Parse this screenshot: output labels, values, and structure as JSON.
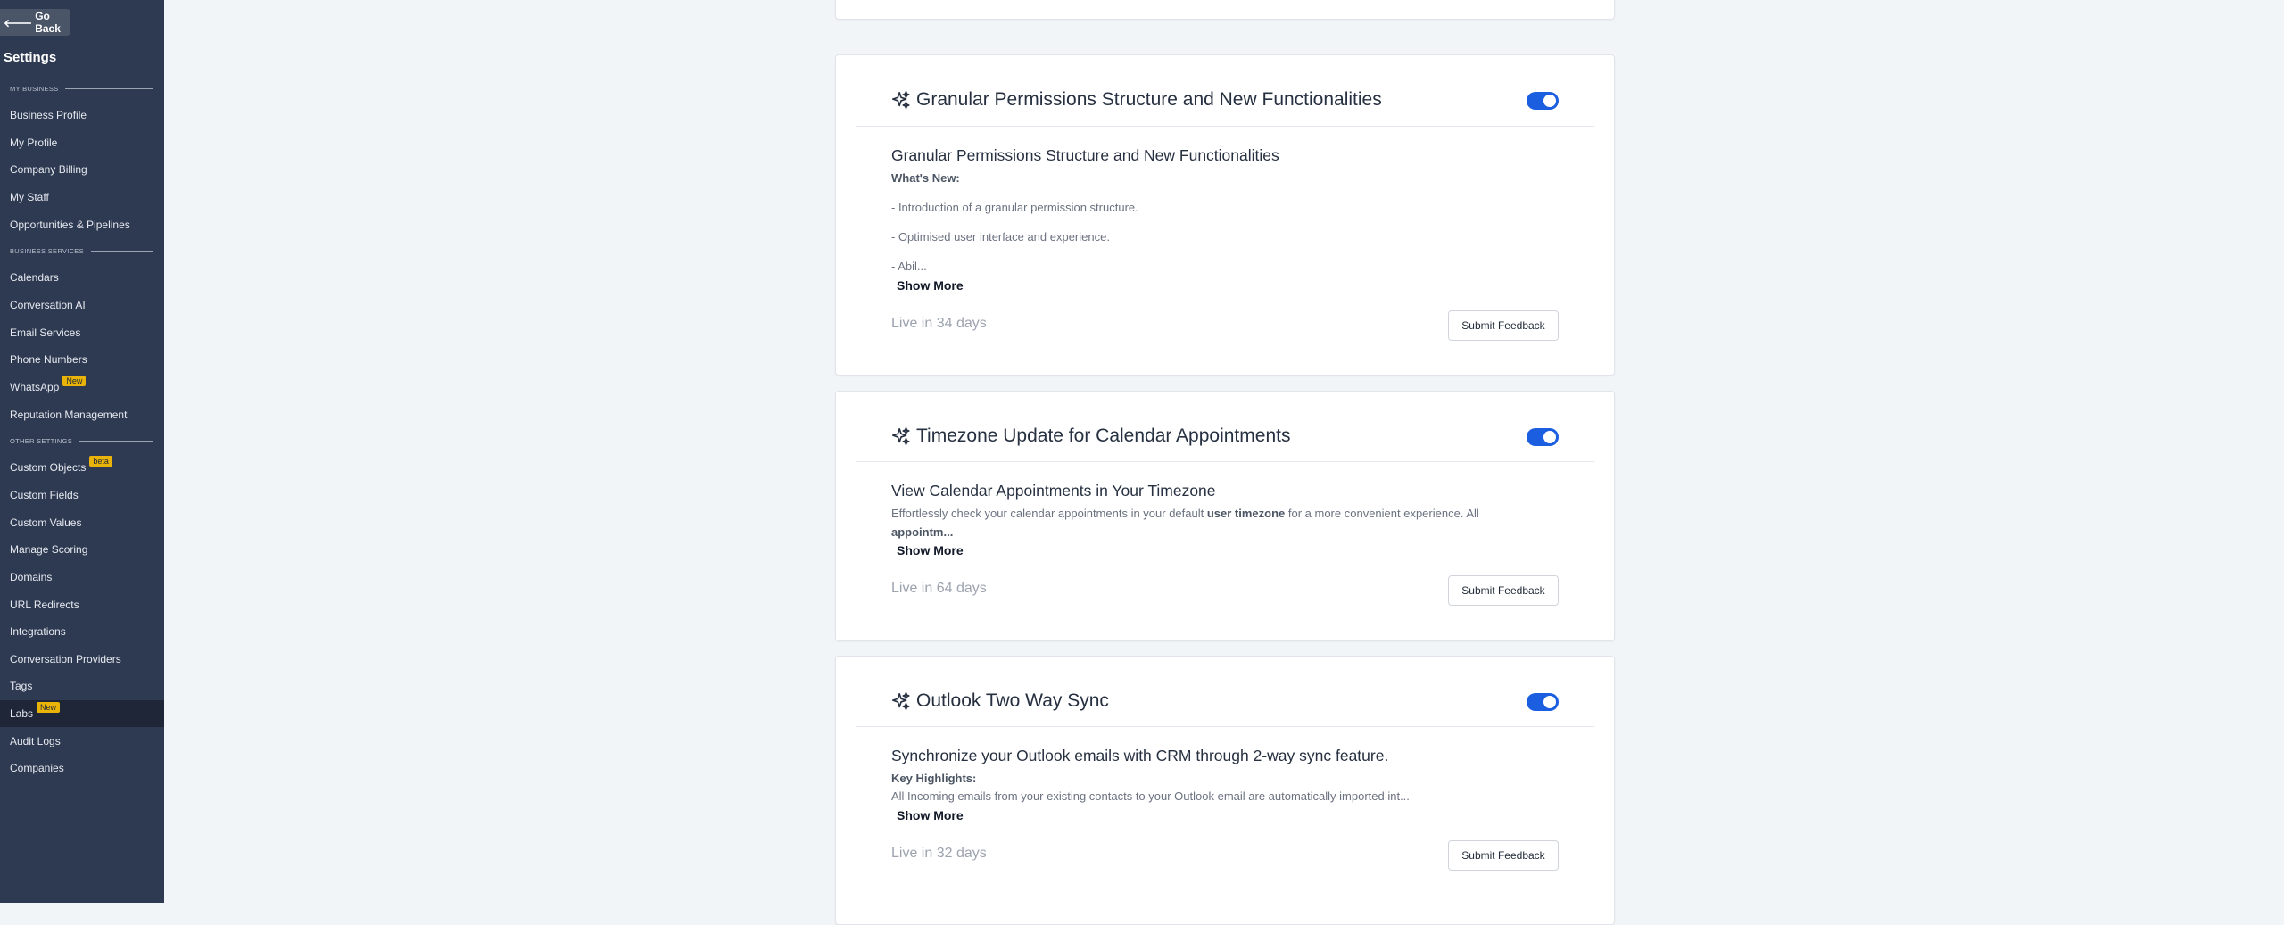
{
  "sidebar": {
    "go_back": "Go Back",
    "title": "Settings",
    "sections": {
      "my_business": "MY BUSINESS",
      "business_services": "BUSINESS SERVICES",
      "other_settings": "OTHER SETTINGS"
    },
    "items": {
      "business_profile": "Business Profile",
      "my_profile": "My Profile",
      "company_billing": "Company Billing",
      "my_staff": "My Staff",
      "opportunities": "Opportunities & Pipelines",
      "calendars": "Calendars",
      "conversation_ai": "Conversation AI",
      "email_services": "Email Services",
      "phone_numbers": "Phone Numbers",
      "whatsapp": "WhatsApp",
      "whatsapp_badge": "New",
      "reputation": "Reputation Management",
      "custom_objects": "Custom Objects",
      "custom_objects_badge": "beta",
      "custom_fields": "Custom Fields",
      "custom_values": "Custom Values",
      "manage_scoring": "Manage Scoring",
      "domains": "Domains",
      "url_redirects": "URL Redirects",
      "integrations": "Integrations",
      "conversation_providers": "Conversation Providers",
      "tags": "Tags",
      "labs": "Labs",
      "labs_badge": "New",
      "audit_logs": "Audit Logs",
      "companies": "Companies"
    }
  },
  "cards": {
    "granular": {
      "title": "Granular Permissions Structure and New Functionalities",
      "enabled": true,
      "subtitle": "Granular Permissions Structure and New Functionalities",
      "whats_new": "What's New:",
      "line1": "- Introduction of a granular permission structure.",
      "line2": "- Optimised user interface and experience.",
      "line3": "- Abil...",
      "show_more": "Show More",
      "live": "Live in 34 days",
      "feedback": "Submit Feedback"
    },
    "timezone": {
      "title": "Timezone Update for Calendar Appointments",
      "enabled": true,
      "subtitle": "View Calendar Appointments in Your Timezone",
      "text_a": "Effortlessly check your calendar appointments in your default ",
      "text_b": "user timezone",
      "text_c": " for a more convenient experience. All",
      "text_d": "appointm...",
      "show_more": "Show More",
      "live": "Live in 64 days",
      "feedback": "Submit Feedback"
    },
    "outlook": {
      "title": "Outlook Two Way Sync",
      "enabled": true,
      "subtitle": "Synchronize your Outlook emails with CRM through 2-way sync feature.",
      "highlights": "Key Highlights:",
      "line1": "All Incoming emails from your existing contacts to your Outlook email are automatically imported int...",
      "show_more": "Show More",
      "live": "Live in 32 days",
      "feedback": "Submit Feedback"
    }
  },
  "colors": {
    "sidebar_bg": "#2e3a52",
    "toggle_on": "#1c5ee0",
    "badge": "#eab308"
  }
}
